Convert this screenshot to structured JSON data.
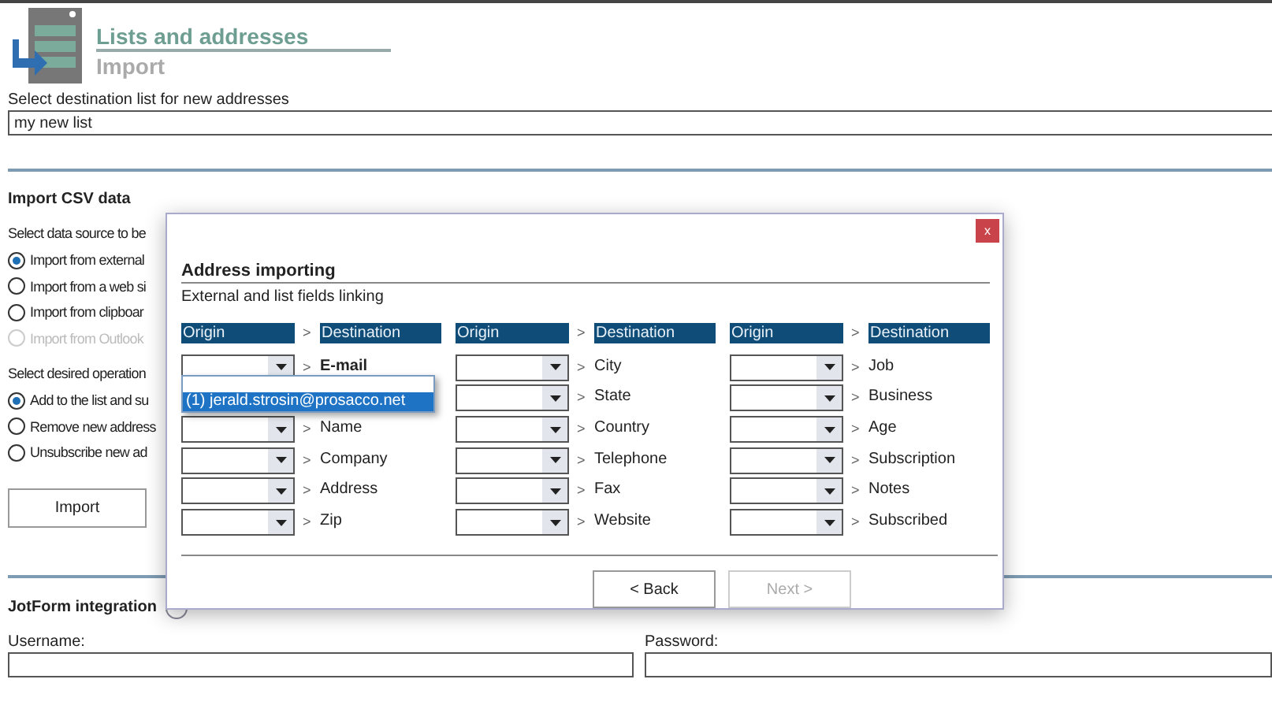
{
  "header": {
    "title": "Lists and addresses",
    "subtitle": "Import"
  },
  "destination": {
    "label": "Select destination list for new addresses",
    "value": "my new list"
  },
  "csv": {
    "heading": "Import CSV data",
    "source_label": "Select data source to be",
    "sources": [
      {
        "label": "Import from external",
        "selected": true,
        "disabled": false
      },
      {
        "label": "Import from a web si",
        "selected": false,
        "disabled": false
      },
      {
        "label": "Import from clipboar",
        "selected": false,
        "disabled": false
      },
      {
        "label": "Import from Outlook",
        "selected": false,
        "disabled": true
      }
    ],
    "operation_label": "Select desired operation",
    "operations": [
      {
        "label": "Add to the list and su",
        "selected": true
      },
      {
        "label": "Remove new address",
        "selected": false
      },
      {
        "label": "Unsubscribe new ad",
        "selected": false
      }
    ],
    "import_button": "Import"
  },
  "jotform": {
    "heading": "JotForm integration",
    "username_label": "Username:",
    "password_label": "Password:"
  },
  "dialog": {
    "close": "x",
    "title": "Address importing",
    "subtitle": "External and list fields linking",
    "columns": [
      {
        "origin_header": "Origin",
        "arrow": ">",
        "destination_header": "Destination",
        "rows": [
          {
            "destination": "E-mail",
            "arrow": ">",
            "required": true
          },
          {
            "destination": "Name",
            "arrow": ">",
            "required": false
          },
          {
            "destination": "Company",
            "arrow": ">",
            "required": false
          },
          {
            "destination": "Address",
            "arrow": ">",
            "required": false
          },
          {
            "destination": "Zip",
            "arrow": ">",
            "required": false
          }
        ]
      },
      {
        "origin_header": "Origin",
        "arrow": ">",
        "destination_header": "Destination",
        "rows": [
          {
            "destination": "City",
            "arrow": ">",
            "required": false
          },
          {
            "destination": "State",
            "arrow": ">",
            "required": false
          },
          {
            "destination": "Country",
            "arrow": ">",
            "required": false
          },
          {
            "destination": "Telephone",
            "arrow": ">",
            "required": false
          },
          {
            "destination": "Fax",
            "arrow": ">",
            "required": false
          },
          {
            "destination": "Website",
            "arrow": ">",
            "required": false
          }
        ]
      },
      {
        "origin_header": "Origin",
        "arrow": ">",
        "destination_header": "Destination",
        "rows": [
          {
            "destination": "Job",
            "arrow": ">",
            "required": false
          },
          {
            "destination": "Business",
            "arrow": ">",
            "required": false
          },
          {
            "destination": "Age",
            "arrow": ">",
            "required": false
          },
          {
            "destination": "Subscription",
            "arrow": ">",
            "required": false
          },
          {
            "destination": "Notes",
            "arrow": ">",
            "required": false
          },
          {
            "destination": "Subscribed",
            "arrow": ">",
            "required": false
          }
        ]
      }
    ],
    "dropdown": {
      "items": [
        {
          "label": "(1) jerald.strosin@prosacco.net",
          "selected": true
        }
      ]
    },
    "buttons": [
      {
        "label": "< Back",
        "disabled": false
      },
      {
        "label": "Next >",
        "disabled": true
      }
    ]
  }
}
